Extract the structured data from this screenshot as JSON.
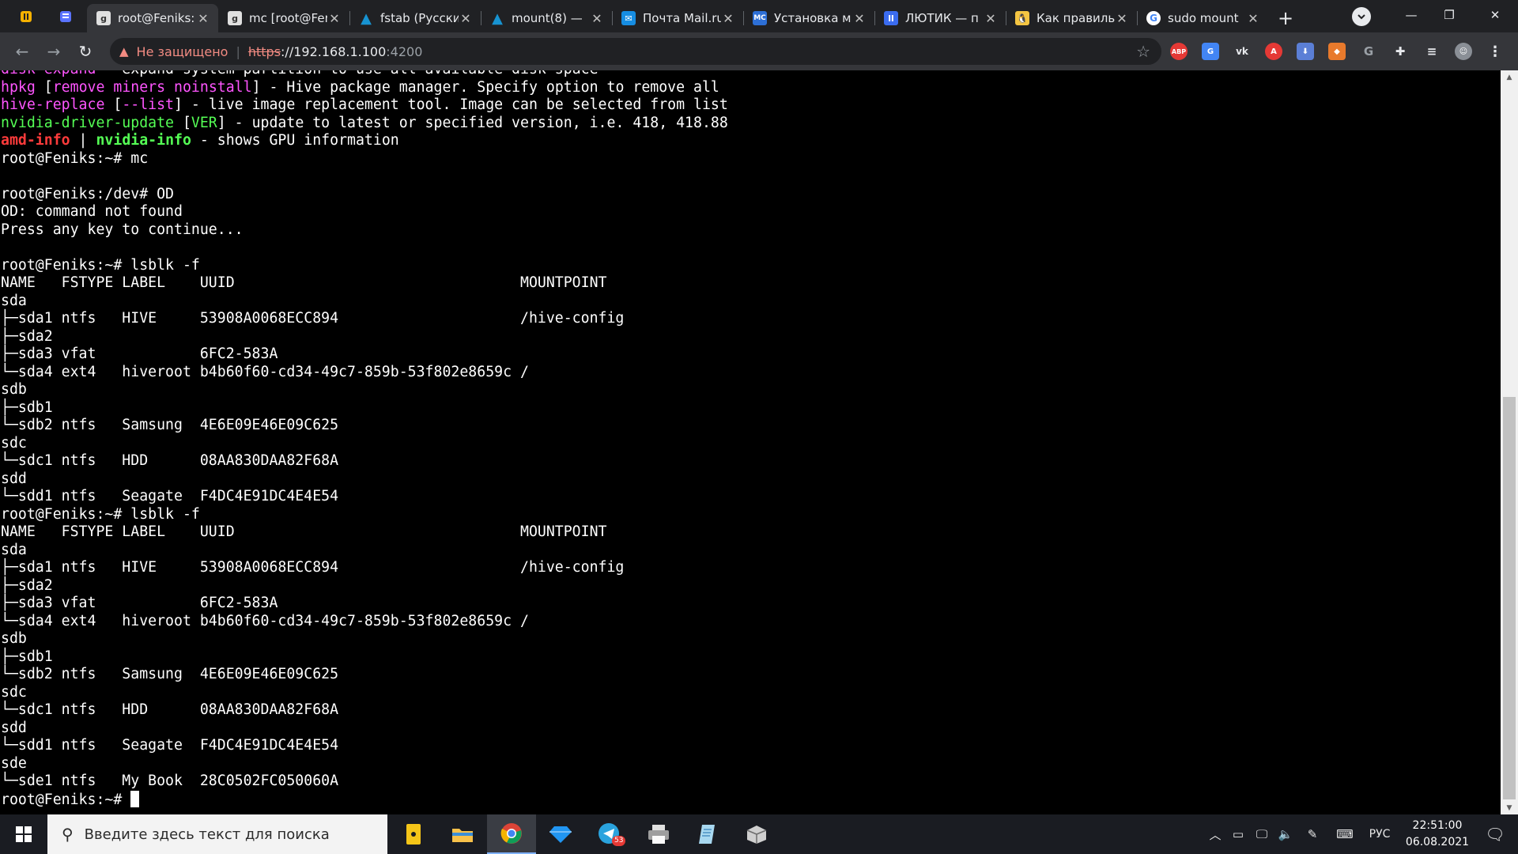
{
  "browser": {
    "tabs": [
      {
        "title": "root@Feniks: ~",
        "active": true,
        "favicon": "shellinabox-icon"
      },
      {
        "title": "mc [root@Feniks]",
        "active": false,
        "favicon": "shellinabox-icon"
      },
      {
        "title": "fstab (Русский)",
        "active": false,
        "favicon": "arch-linux-icon"
      },
      {
        "title": "mount(8) — ",
        "active": false,
        "favicon": "arch-linux-icon"
      },
      {
        "title": "Почта Mail.ru",
        "active": false,
        "favicon": "mail-icon"
      },
      {
        "title": "Установка м",
        "active": false,
        "favicon": "ms-icon"
      },
      {
        "title": "ЛЮТИК — п",
        "active": false,
        "favicon": "lutik-icon"
      },
      {
        "title": "Как правиль",
        "active": false,
        "favicon": "linux-tux-icon"
      },
      {
        "title": "sudo mount",
        "active": false,
        "favicon": "google-icon"
      }
    ],
    "address": {
      "security_label": "Не защищено",
      "scheme": "https",
      "host": "://192.168.1.100",
      "port": ":4200"
    },
    "extensions": [
      "ABP",
      "translate",
      "VK",
      "A",
      "download",
      "fox",
      "G",
      "puzzle",
      "list",
      "avatar",
      "menu"
    ]
  },
  "terminal": {
    "lines": [
      [
        {
          "t": "disk-expand",
          "c": "mag"
        },
        {
          "t": " - expand system partition to use all available disk space"
        }
      ],
      [
        {
          "t": "hpkg",
          "c": "mag"
        },
        {
          "t": " ["
        },
        {
          "t": "remove miners noinstall",
          "c": "mag"
        },
        {
          "t": "] - Hive package manager. Specify option to remove all"
        }
      ],
      [
        {
          "t": "hive-replace",
          "c": "mag"
        },
        {
          "t": " ["
        },
        {
          "t": "--list",
          "c": "mag"
        },
        {
          "t": "] - live image replacement tool. Image can be selected from list"
        }
      ],
      [
        {
          "t": "nvidia-driver-update",
          "c": "grn"
        },
        {
          "t": " ["
        },
        {
          "t": "VER",
          "c": "grn"
        },
        {
          "t": "] - update to latest or specified version, i.e. 418, 418.88"
        }
      ],
      [
        {
          "t": "amd-info",
          "c": "red"
        },
        {
          "t": " | "
        },
        {
          "t": "nvidia-info",
          "c": "bgrn"
        },
        {
          "t": " - shows GPU information"
        }
      ],
      [
        {
          "t": "root@Feniks:~# mc"
        }
      ],
      [
        {
          "t": ""
        }
      ],
      [
        {
          "t": "root@Feniks:/dev# OD"
        }
      ],
      [
        {
          "t": "OD: command not found"
        }
      ],
      [
        {
          "t": "Press any key to continue..."
        }
      ],
      [
        {
          "t": ""
        }
      ],
      [
        {
          "t": "root@Feniks:~# lsblk -f"
        }
      ],
      [
        {
          "t": "NAME   FSTYPE LABEL    UUID                                 MOUNTPOINT"
        }
      ],
      [
        {
          "t": "sda"
        }
      ],
      [
        {
          "t": "├─sda1 ntfs   HIVE     53908A0068ECC894                     /hive-config"
        }
      ],
      [
        {
          "t": "├─sda2"
        }
      ],
      [
        {
          "t": "├─sda3 vfat            6FC2-583A"
        }
      ],
      [
        {
          "t": "└─sda4 ext4   hiveroot b4b60f60-cd34-49c7-859b-53f802e8659c /"
        }
      ],
      [
        {
          "t": "sdb"
        }
      ],
      [
        {
          "t": "├─sdb1"
        }
      ],
      [
        {
          "t": "└─sdb2 ntfs   Samsung  4E6E09E46E09C625"
        }
      ],
      [
        {
          "t": "sdc"
        }
      ],
      [
        {
          "t": "└─sdc1 ntfs   HDD      08AA830DAA82F68A"
        }
      ],
      [
        {
          "t": "sdd"
        }
      ],
      [
        {
          "t": "└─sdd1 ntfs   Seagate  F4DC4E91DC4E4E54"
        }
      ],
      [
        {
          "t": "root@Feniks:~# lsblk -f"
        }
      ],
      [
        {
          "t": "NAME   FSTYPE LABEL    UUID                                 MOUNTPOINT"
        }
      ],
      [
        {
          "t": "sda"
        }
      ],
      [
        {
          "t": "├─sda1 ntfs   HIVE     53908A0068ECC894                     /hive-config"
        }
      ],
      [
        {
          "t": "├─sda2"
        }
      ],
      [
        {
          "t": "├─sda3 vfat            6FC2-583A"
        }
      ],
      [
        {
          "t": "└─sda4 ext4   hiveroot b4b60f60-cd34-49c7-859b-53f802e8659c /"
        }
      ],
      [
        {
          "t": "sdb"
        }
      ],
      [
        {
          "t": "├─sdb1"
        }
      ],
      [
        {
          "t": "└─sdb2 ntfs   Samsung  4E6E09E46E09C625"
        }
      ],
      [
        {
          "t": "sdc"
        }
      ],
      [
        {
          "t": "└─sdc1 ntfs   HDD      08AA830DAA82F68A"
        }
      ],
      [
        {
          "t": "sdd"
        }
      ],
      [
        {
          "t": "└─sdd1 ntfs   Seagate  F4DC4E91DC4E4E54"
        }
      ],
      [
        {
          "t": "sde"
        }
      ],
      [
        {
          "t": "└─sde1 ntfs   My Book  28C0502FC050060A"
        }
      ],
      [
        {
          "t": "root@Feniks:~# "
        }
      ]
    ],
    "colors": {
      "mag": "#ff55ff",
      "grn": "#55ff55",
      "red": "#ff3b3b",
      "bgrn": "#55ff55"
    }
  },
  "taskbar": {
    "search_placeholder": "Введите здесь текст для поиска",
    "apps": [
      "explorer-note-icon",
      "file-explorer-icon",
      "chrome-icon",
      "gem-icon",
      "telegram-icon",
      "printer-icon",
      "notepad-icon",
      "package-icon"
    ],
    "telegram_badge": "53",
    "language": "РУС",
    "time": "22:51:00",
    "date": "06.08.2021"
  }
}
